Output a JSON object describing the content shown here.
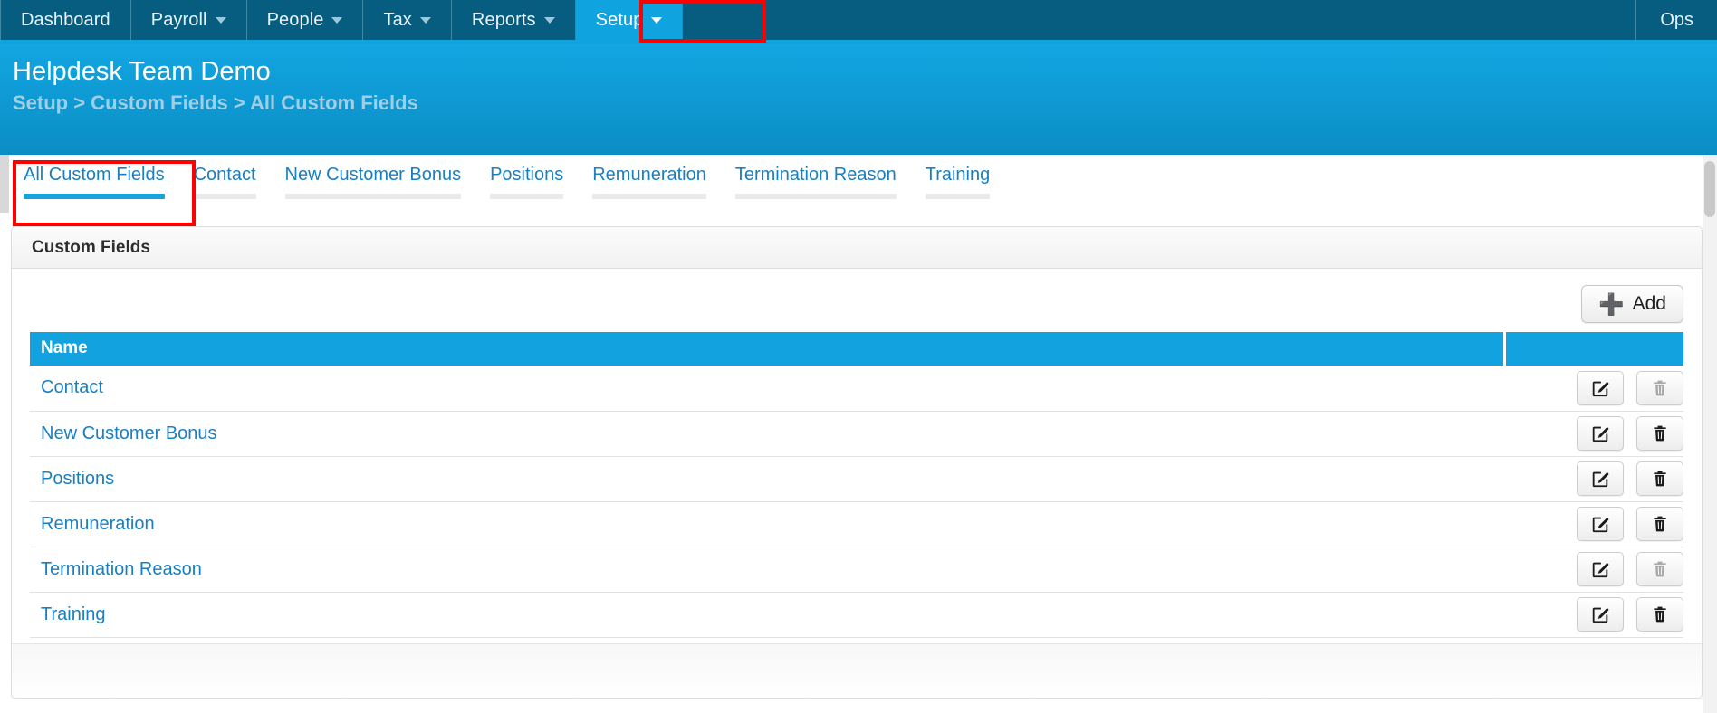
{
  "topnav": {
    "items": [
      {
        "label": "Dashboard",
        "has_caret": false,
        "active": false
      },
      {
        "label": "Payroll",
        "has_caret": true,
        "active": false
      },
      {
        "label": "People",
        "has_caret": true,
        "active": false
      },
      {
        "label": "Tax",
        "has_caret": true,
        "active": false
      },
      {
        "label": "Reports",
        "has_caret": true,
        "active": false
      },
      {
        "label": "Setup",
        "has_caret": true,
        "active": true
      }
    ],
    "right_item": "Ops",
    "active_bg": "#0fa3e0",
    "bar_bg": "#065d80"
  },
  "header": {
    "title": "Helpdesk Team Demo",
    "breadcrumb": "Setup > Custom Fields > All Custom Fields"
  },
  "tabs": [
    {
      "label": "All Custom Fields",
      "active": true
    },
    {
      "label": "Contact",
      "active": false
    },
    {
      "label": "New Customer Bonus",
      "active": false
    },
    {
      "label": "Positions",
      "active": false
    },
    {
      "label": "Remuneration",
      "active": false
    },
    {
      "label": "Termination Reason",
      "active": false
    },
    {
      "label": "Training",
      "active": false
    }
  ],
  "panel": {
    "title": "Custom Fields",
    "add_button": "Add",
    "add_icon": "plus-icon"
  },
  "table": {
    "columns": [
      "Name",
      ""
    ],
    "rows": [
      {
        "name": "Contact",
        "edit_icon": "edit-pencil-icon",
        "delete_icon": "trash-icon",
        "delete_enabled": false
      },
      {
        "name": "New Customer Bonus",
        "edit_icon": "edit-pencil-icon",
        "delete_icon": "trash-icon",
        "delete_enabled": true
      },
      {
        "name": "Positions",
        "edit_icon": "edit-pencil-icon",
        "delete_icon": "trash-icon",
        "delete_enabled": true
      },
      {
        "name": "Remuneration",
        "edit_icon": "edit-pencil-icon",
        "delete_icon": "trash-icon",
        "delete_enabled": true
      },
      {
        "name": "Termination Reason",
        "edit_icon": "edit-pencil-icon",
        "delete_icon": "trash-icon",
        "delete_enabled": false
      },
      {
        "name": "Training",
        "edit_icon": "edit-pencil-icon",
        "delete_icon": "trash-icon",
        "delete_enabled": true
      }
    ]
  },
  "colors": {
    "nav_dark_blue": "#065d80",
    "accent_blue": "#0fa3e0",
    "link_blue": "#1a7fc1",
    "highlight_red": "#ff0000"
  }
}
